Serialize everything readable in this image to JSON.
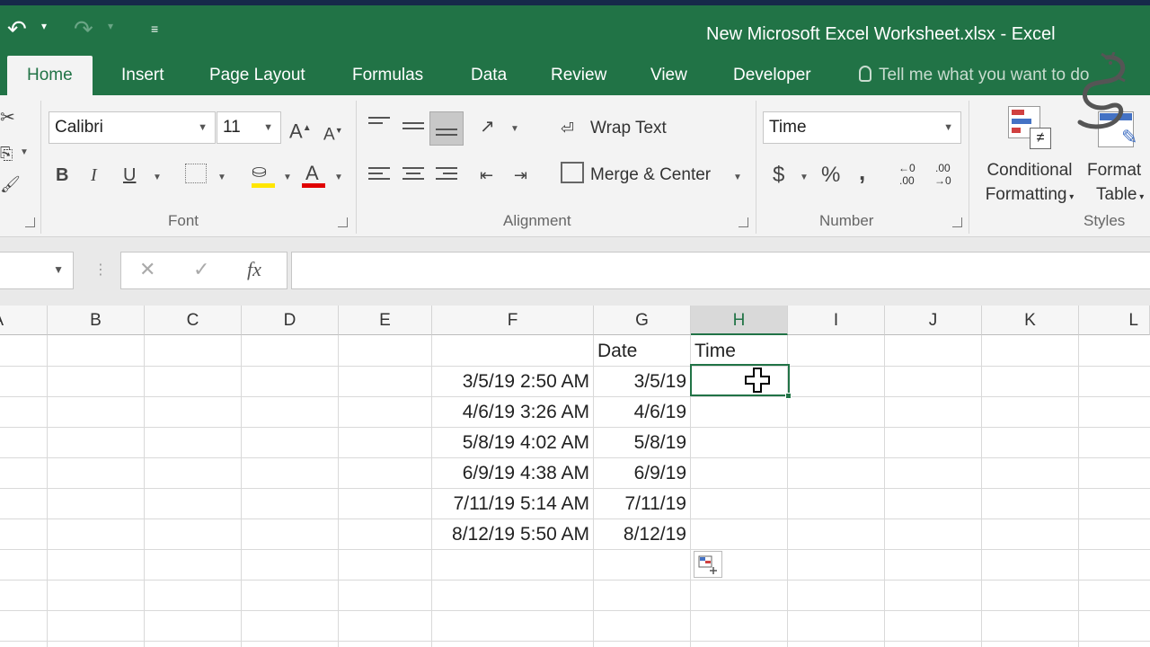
{
  "window": {
    "title": "New Microsoft Excel Worksheet.xlsx - Excel"
  },
  "qat": {
    "undo_icon": "undo-icon",
    "redo_icon": "redo-icon",
    "customize_icon": "customize-qat-icon"
  },
  "tabs": [
    {
      "label": "Home",
      "active": true
    },
    {
      "label": "Insert"
    },
    {
      "label": "Page Layout"
    },
    {
      "label": "Formulas"
    },
    {
      "label": "Data"
    },
    {
      "label": "Review"
    },
    {
      "label": "View"
    },
    {
      "label": "Developer"
    }
  ],
  "tell_me": {
    "placeholder": "Tell me what you want to do"
  },
  "ribbon": {
    "font": {
      "label": "Font",
      "name": "Calibri",
      "size": "11",
      "grow": "A",
      "shrink": "A",
      "bold": "B",
      "italic": "I",
      "underline": "U",
      "font_color_letter": "A"
    },
    "alignment": {
      "label": "Alignment",
      "wrap_text": "Wrap Text",
      "merge_center": "Merge & Center"
    },
    "number": {
      "label": "Number",
      "format": "Time",
      "currency": "$",
      "percent": "%",
      "comma": ",",
      "inc_decimal_top": "←0",
      "inc_decimal_bottom": ".00",
      "dec_decimal_top": ".00",
      "dec_decimal_bottom": "→0"
    },
    "styles": {
      "label": "Styles",
      "conditional_line1": "Conditional",
      "conditional_line2": "Formatting",
      "format_line1": "Format",
      "format_line2": "Table"
    }
  },
  "formula_bar": {
    "cancel": "✕",
    "enter": "✓",
    "fx": "fx",
    "value": ""
  },
  "grid": {
    "columns": [
      "A",
      "B",
      "C",
      "D",
      "E",
      "F",
      "G",
      "H",
      "I",
      "J",
      "K",
      "L"
    ],
    "selected_column": "H",
    "headers": {
      "date": "Date",
      "time": "Time"
    },
    "rows": [
      {
        "datetime": "3/5/19 2:50 AM",
        "date": "3/5/19"
      },
      {
        "datetime": "4/6/19 3:26 AM",
        "date": "4/6/19"
      },
      {
        "datetime": "5/8/19 4:02 AM",
        "date": "5/8/19"
      },
      {
        "datetime": "6/9/19 4:38 AM",
        "date": "6/9/19"
      },
      {
        "datetime": "7/11/19 5:14 AM",
        "date": "7/11/19"
      },
      {
        "datetime": "8/12/19 5:50 AM",
        "date": "8/12/19"
      }
    ]
  },
  "colors": {
    "accent": "#217346",
    "font_color_bar": "#e00000",
    "fill_color_bar": "#ffe600"
  }
}
